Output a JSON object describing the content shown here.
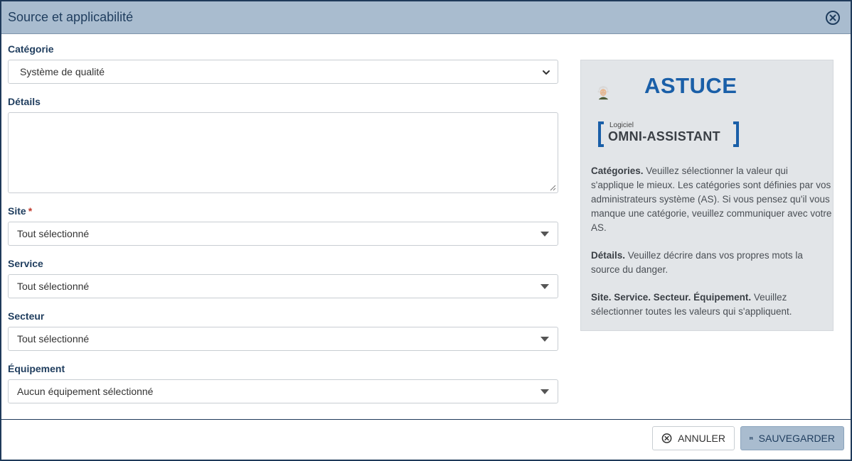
{
  "dialog": {
    "title": "Source et applicabilité"
  },
  "form": {
    "category": {
      "label": "Catégorie",
      "value": "Système de qualité"
    },
    "details": {
      "label": "Détails",
      "value": ""
    },
    "site": {
      "label": "Site",
      "required_mark": "*",
      "value": "Tout sélectionné"
    },
    "service": {
      "label": "Service",
      "value": "Tout sélectionné"
    },
    "sector": {
      "label": "Secteur",
      "value": "Tout sélectionné"
    },
    "equipment": {
      "label": "Équipement",
      "value": "Aucun équipement sélectionné"
    }
  },
  "tip": {
    "title": "ASTUCE",
    "brand_small": "Logiciel",
    "brand_big": "OMNI-ASSISTANT",
    "paragraphs": [
      {
        "bold": "Catégories.",
        "text": " Veuillez sélectionner la valeur qui s'applique le mieux. Les catégories sont définies par vos administrateurs système (AS). Si vous pensez qu'il vous manque une catégorie, veuillez communiquer avec votre AS."
      },
      {
        "bold": "Détails.",
        "text": " Veuillez décrire dans vos propres mots la source du danger."
      },
      {
        "bold": "Site. Service. Secteur. Équipement.",
        "text": " Veuillez sélectionner toutes les valeurs qui s'appliquent."
      }
    ]
  },
  "footer": {
    "cancel_label": "ANNULER",
    "save_label": "SAUVEGARDER"
  },
  "colors": {
    "header_bg": "#a9bccf",
    "title_text": "#1f3d5e",
    "tip_accent": "#1a5fa8",
    "required": "#c0392b"
  }
}
